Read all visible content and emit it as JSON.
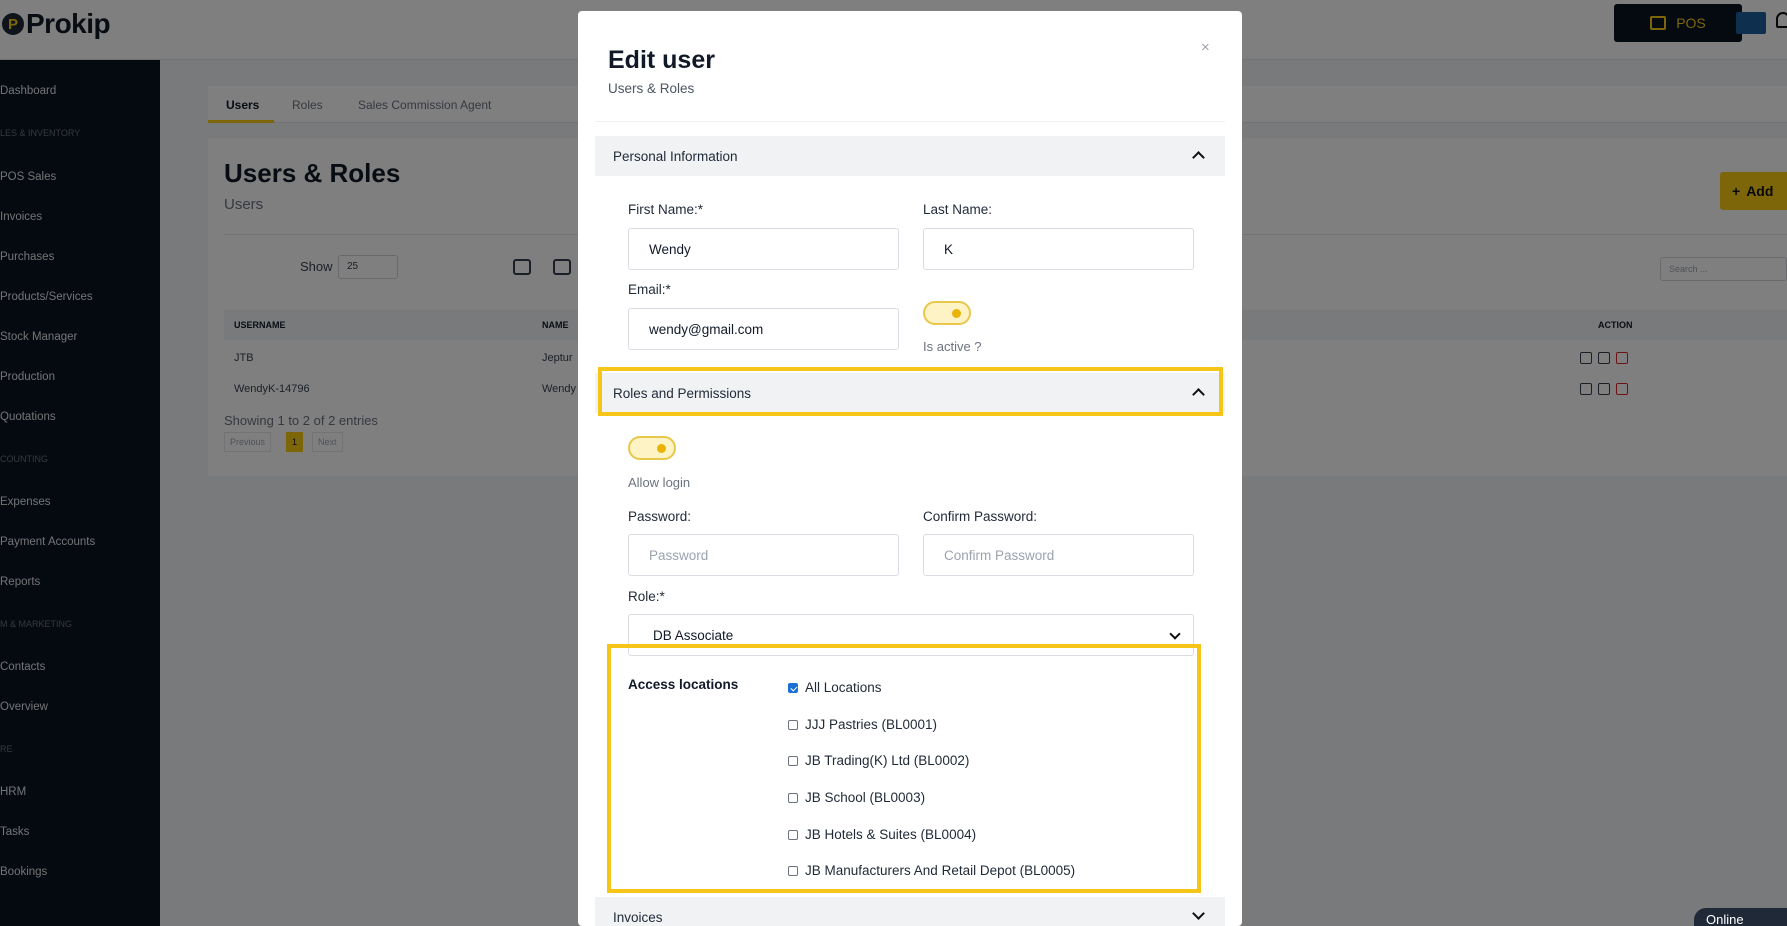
{
  "app": {
    "logo_text": "Prokip",
    "pos_label": "POS",
    "online_label": "Online"
  },
  "sidebar": {
    "items": [
      "Dashboard",
      "POS Sales",
      "Invoices",
      "Purchases",
      "Products/Services",
      "Stock Manager",
      "Production",
      "Quotations",
      "Expenses",
      "Payment Accounts",
      "Reports",
      "Contacts",
      "Overview",
      "HRM",
      "Tasks",
      "Bookings"
    ],
    "sections": [
      "LES & INVENTORY",
      "COUNTING",
      "M & MARKETING",
      "RE"
    ]
  },
  "page": {
    "tabs": [
      "Users",
      "Roles",
      "Sales Commission Agent"
    ],
    "title": "Users & Roles",
    "subtitle": "Users",
    "add_label": "Add",
    "show_label": "Show",
    "show_value": "25",
    "search_placeholder": "Search ...",
    "columns": [
      "USERNAME",
      "NAME",
      "ACTION"
    ],
    "rows": [
      {
        "username": "JTB",
        "name": "Jeptur"
      },
      {
        "username": "WendyK-14796",
        "name": "Wendy"
      }
    ],
    "showing": "Showing 1 to 2 of 2 entries",
    "pagination": {
      "previous": "Previous",
      "current": "1",
      "next": "Next"
    }
  },
  "modal": {
    "title": "Edit user",
    "subtitle": "Users & Roles",
    "close": "×",
    "personal_section": "Personal Information",
    "first_name_label": "First Name:*",
    "first_name_value": "Wendy",
    "last_name_label": "Last Name:",
    "last_name_value": "K",
    "email_label": "Email:*",
    "email_value": "wendy@gmail.com",
    "is_active_label": "Is active ?",
    "roles_section": "Roles and Permissions",
    "allow_login_label": "Allow login",
    "password_label": "Password:",
    "password_placeholder": "Password",
    "confirm_password_label": "Confirm Password:",
    "confirm_password_placeholder": "Confirm Password",
    "role_label": "Role:*",
    "role_value": "DB Associate",
    "access_title": "Access locations",
    "locations": [
      {
        "label": "All Locations",
        "checked": true
      },
      {
        "label": "JJJ Pastries (BL0001)",
        "checked": false
      },
      {
        "label": "JB Trading(K) Ltd (BL0002)",
        "checked": false
      },
      {
        "label": "JB School (BL0003)",
        "checked": false
      },
      {
        "label": "JB Hotels & Suites (BL0004)",
        "checked": false
      },
      {
        "label": "JB Manufacturers And Retail Depot (BL0005)",
        "checked": false
      }
    ],
    "invoices_section": "Invoices"
  },
  "colors": {
    "highlight": "#f5c518",
    "accent": "#facc15",
    "sidebar_bg": "#0b1220",
    "checkbox": "#1d6fd8"
  }
}
